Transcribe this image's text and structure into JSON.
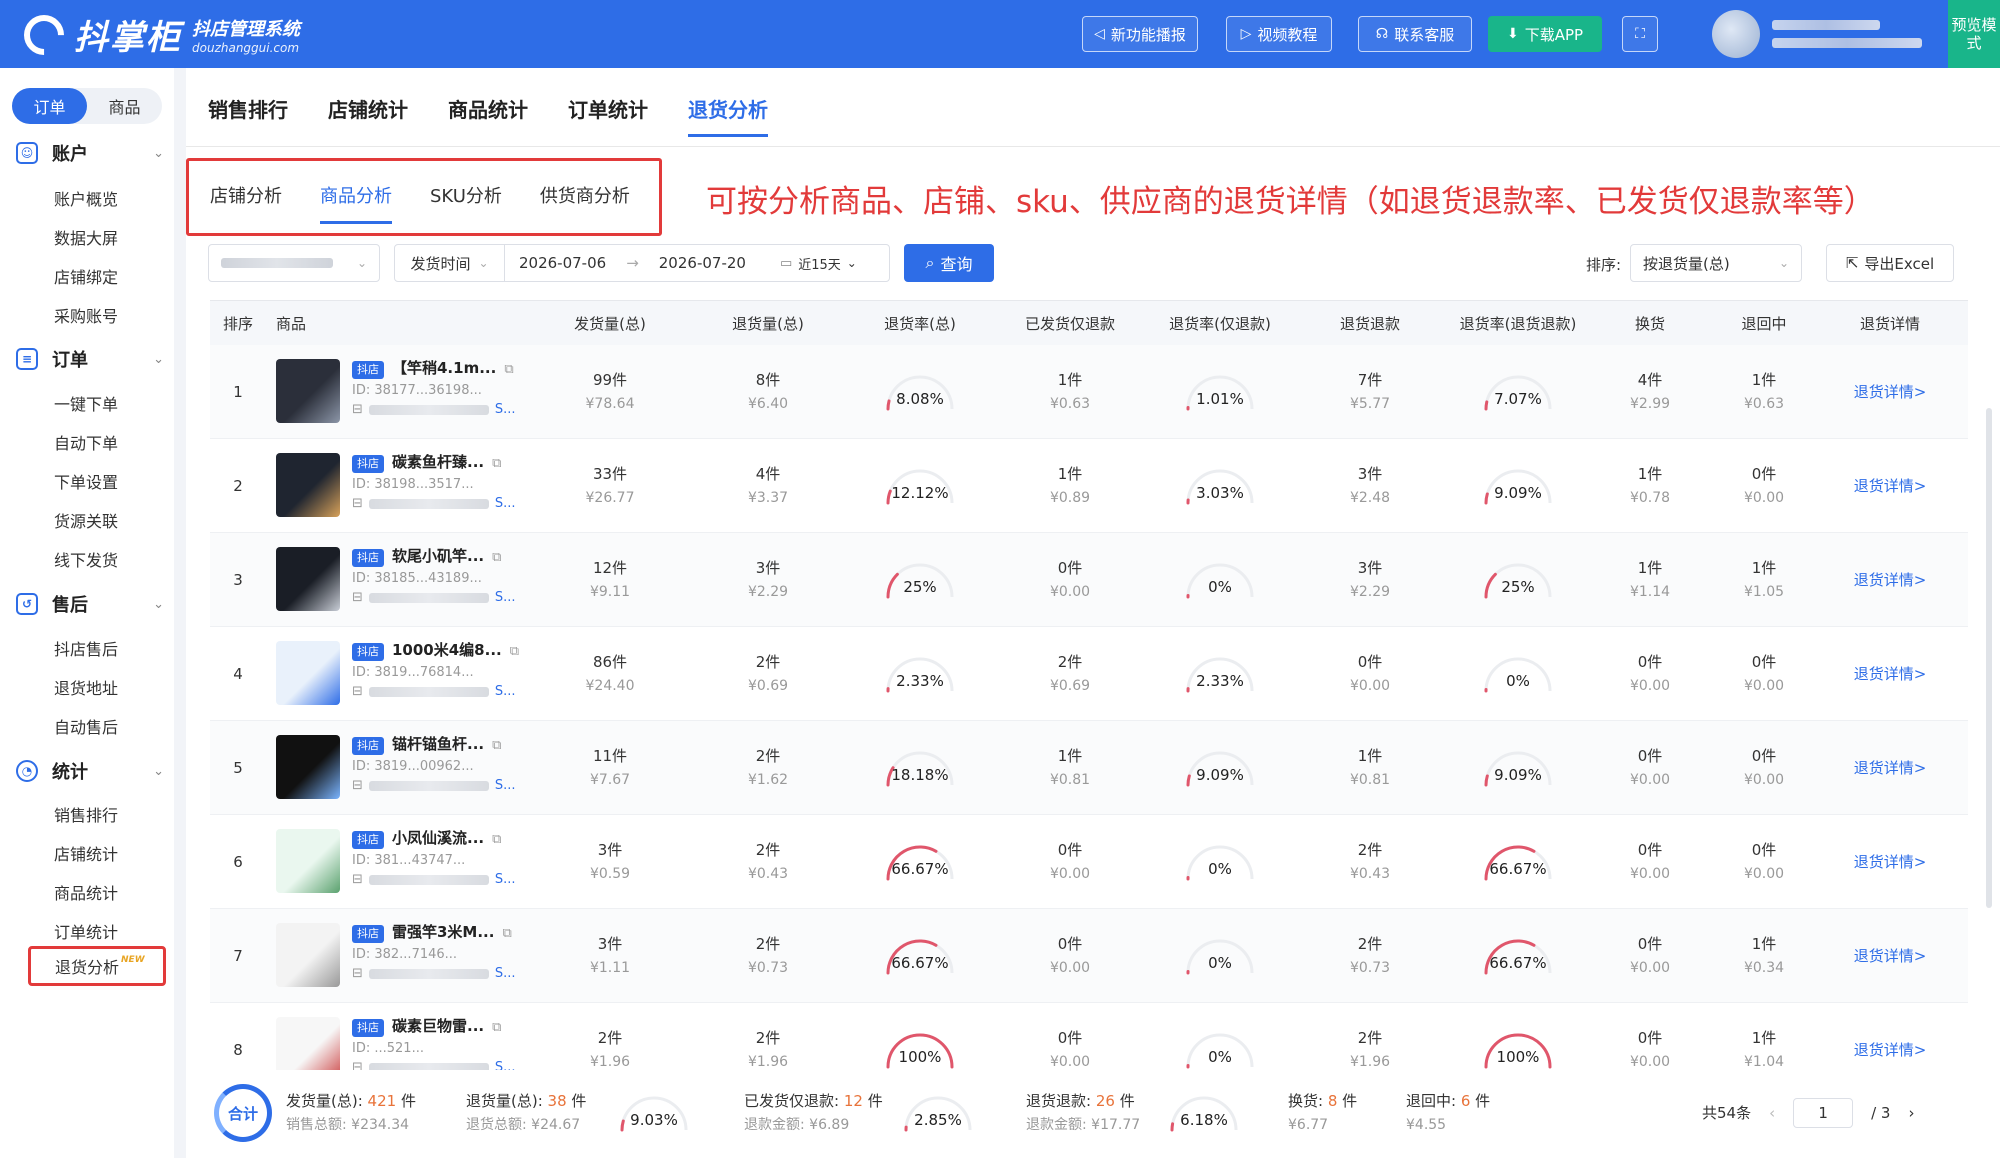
{
  "header": {
    "logo_name": "抖掌柜",
    "logo_title": "抖店管理系统",
    "logo_domain": "douzhanggui.com",
    "buttons": [
      "新功能播报",
      "视频教程",
      "联系客服",
      "下载APP"
    ],
    "preview_label": "预览模式"
  },
  "sidebar": {
    "segment": [
      "订单",
      "商品"
    ],
    "sections": [
      {
        "title": "账户",
        "items": [
          "账户概览",
          "数据大屏",
          "店铺绑定",
          "采购账号"
        ]
      },
      {
        "title": "订单",
        "items": [
          "一键下单",
          "自动下单",
          "下单设置",
          "货源关联",
          "线下发货"
        ]
      },
      {
        "title": "售后",
        "items": [
          "抖店售后",
          "退货地址",
          "自动售后"
        ]
      },
      {
        "title": "统计",
        "items": [
          "销售排行",
          "店铺统计",
          "商品统计",
          "订单统计",
          "退货分析"
        ]
      }
    ],
    "new_badge": "NEW"
  },
  "top_tabs": [
    "销售排行",
    "店铺统计",
    "商品统计",
    "订单统计",
    "退货分析"
  ],
  "sub_tabs": [
    "店铺分析",
    "商品分析",
    "SKU分析",
    "供货商分析"
  ],
  "annotation": "可按分析商品、店铺、sku、供应商的退货详情（如退货退款率、已发货仅退款率等）",
  "filters": {
    "time_type": "发货时间",
    "date_start": "2026-07-06",
    "date_end": "2026-07-20",
    "quick_range": "近15天",
    "query_label": "查询",
    "sort_label": "排序:",
    "sort_value": "按退货量(总)",
    "export_label": "导出Excel"
  },
  "table": {
    "headers": [
      "排序",
      "商品",
      "发货量(总)",
      "退货量(总)",
      "退货率(总)",
      "已发货仅退款",
      "退货率(仅退款)",
      "退货退款",
      "退货率(退货退款)",
      "换货",
      "退回中",
      "退货详情"
    ],
    "tag": "抖店",
    "detail_label": "退货详情>",
    "rows": [
      {
        "rank": "1",
        "name": "【竿稍4.1m...",
        "id": "ID: 38177...36198...",
        "ship": "99件",
        "ship_amt": "¥78.64",
        "ret": "8件",
        "ret_amt": "¥6.40",
        "rate_total": "8.08%",
        "rt": 8.08,
        "refund_only": "1件",
        "refund_only_amt": "¥0.63",
        "rate_refund": "1.01%",
        "rr": 1.01,
        "ret_refund": "7件",
        "ret_refund_amt": "¥5.77",
        "rate_ret_refund": "7.07%",
        "rrr": 7.07,
        "exchange": "4件",
        "exchange_amt": "¥2.99",
        "returning": "1件",
        "returning_amt": "¥0.63"
      },
      {
        "rank": "2",
        "name": "碳素鱼杆臻...",
        "id": "ID: 38198...3517...",
        "ship": "33件",
        "ship_amt": "¥26.77",
        "ret": "4件",
        "ret_amt": "¥3.37",
        "rate_total": "12.12%",
        "rt": 12.12,
        "refund_only": "1件",
        "refund_only_amt": "¥0.89",
        "rate_refund": "3.03%",
        "rr": 3.03,
        "ret_refund": "3件",
        "ret_refund_amt": "¥2.48",
        "rate_ret_refund": "9.09%",
        "rrr": 9.09,
        "exchange": "1件",
        "exchange_amt": "¥0.78",
        "returning": "0件",
        "returning_amt": "¥0.00"
      },
      {
        "rank": "3",
        "name": "软尾小矶竿...",
        "id": "ID: 38185...43189...",
        "ship": "12件",
        "ship_amt": "¥9.11",
        "ret": "3件",
        "ret_amt": "¥2.29",
        "rate_total": "25%",
        "rt": 25,
        "refund_only": "0件",
        "refund_only_amt": "¥0.00",
        "rate_refund": "0%",
        "rr": 0,
        "ret_refund": "3件",
        "ret_refund_amt": "¥2.29",
        "rate_ret_refund": "25%",
        "rrr": 25,
        "exchange": "1件",
        "exchange_amt": "¥1.14",
        "returning": "1件",
        "returning_amt": "¥1.05"
      },
      {
        "rank": "4",
        "name": "1000米4编8...",
        "id": "ID: 3819...76814...",
        "ship": "86件",
        "ship_amt": "¥24.40",
        "ret": "2件",
        "ret_amt": "¥0.69",
        "rate_total": "2.33%",
        "rt": 2.33,
        "refund_only": "2件",
        "refund_only_amt": "¥0.69",
        "rate_refund": "2.33%",
        "rr": 2.33,
        "ret_refund": "0件",
        "ret_refund_amt": "¥0.00",
        "rate_ret_refund": "0%",
        "rrr": 0,
        "exchange": "0件",
        "exchange_amt": "¥0.00",
        "returning": "0件",
        "returning_amt": "¥0.00"
      },
      {
        "rank": "5",
        "name": "锚杆锚鱼杆...",
        "id": "ID: 3819...00962...",
        "ship": "11件",
        "ship_amt": "¥7.67",
        "ret": "2件",
        "ret_amt": "¥1.62",
        "rate_total": "18.18%",
        "rt": 18.18,
        "refund_only": "1件",
        "refund_only_amt": "¥0.81",
        "rate_refund": "9.09%",
        "rr": 9.09,
        "ret_refund": "1件",
        "ret_refund_amt": "¥0.81",
        "rate_ret_refund": "9.09%",
        "rrr": 9.09,
        "exchange": "0件",
        "exchange_amt": "¥0.00",
        "returning": "0件",
        "returning_amt": "¥0.00"
      },
      {
        "rank": "6",
        "name": "小凤仙溪流...",
        "id": "ID: 381...43747...",
        "ship": "3件",
        "ship_amt": "¥0.59",
        "ret": "2件",
        "ret_amt": "¥0.43",
        "rate_total": "66.67%",
        "rt": 66.67,
        "refund_only": "0件",
        "refund_only_amt": "¥0.00",
        "rate_refund": "0%",
        "rr": 0,
        "ret_refund": "2件",
        "ret_refund_amt": "¥0.43",
        "rate_ret_refund": "66.67%",
        "rrr": 66.67,
        "exchange": "0件",
        "exchange_amt": "¥0.00",
        "returning": "0件",
        "returning_amt": "¥0.00"
      },
      {
        "rank": "7",
        "name": "雷强竿3米M...",
        "id": "ID: 382...7146...",
        "ship": "3件",
        "ship_amt": "¥1.11",
        "ret": "2件",
        "ret_amt": "¥0.73",
        "rate_total": "66.67%",
        "rt": 66.67,
        "refund_only": "0件",
        "refund_only_amt": "¥0.00",
        "rate_refund": "0%",
        "rr": 0,
        "ret_refund": "2件",
        "ret_refund_amt": "¥0.73",
        "rate_ret_refund": "66.67%",
        "rrr": 66.67,
        "exchange": "0件",
        "exchange_amt": "¥0.00",
        "returning": "1件",
        "returning_amt": "¥0.34"
      },
      {
        "rank": "8",
        "name": "碳素巨物雷...",
        "id": "ID: ...521...",
        "ship": "2件",
        "ship_amt": "¥1.96",
        "ret": "2件",
        "ret_amt": "¥1.96",
        "rate_total": "100%",
        "rt": 100,
        "refund_only": "0件",
        "refund_only_amt": "¥0.00",
        "rate_refund": "0%",
        "rr": 0,
        "ret_refund": "2件",
        "ret_refund_amt": "¥1.96",
        "rate_ret_refund": "100%",
        "rrr": 100,
        "exchange": "0件",
        "exchange_amt": "¥0.00",
        "returning": "1件",
        "returning_amt": "¥1.04"
      }
    ]
  },
  "footer": {
    "total_label": "合计",
    "ship_label": "发货量(总):",
    "ship_value": "421",
    "ship_unit": "件",
    "sales_label": "销售总额: ¥234.34",
    "ret_label": "退货量(总):",
    "ret_value": "38",
    "ret_unit": "件",
    "ret_amount": "退货总额: ¥24.67",
    "ret_rate": "9.03%",
    "ret_rate_num": 9.03,
    "refund_label": "已发货仅退款:",
    "refund_value": "12",
    "refund_unit": "件",
    "refund_amount": "退款金额: ¥6.89",
    "refund_rate": "2.85%",
    "refund_rate_num": 2.85,
    "rr_label": "退货退款:",
    "rr_value": "26",
    "rr_unit": "件",
    "rr_amount": "退款金额: ¥17.77",
    "rr_rate": "6.18%",
    "rr_rate_num": 6.18,
    "ex_label": "换货:",
    "ex_value": "8",
    "ex_unit": "件",
    "ex_amount": "¥6.77",
    "back_label": "退回中:",
    "back_value": "6",
    "back_unit": "件",
    "back_amount": "¥4.55",
    "total_count": "共54条",
    "page": "1",
    "pages": "/ 3"
  },
  "colors": {
    "primary": "#2e6de7",
    "green": "#19b58a",
    "highlight_red": "#e23a3a",
    "gauge_red": "#e0566b"
  }
}
